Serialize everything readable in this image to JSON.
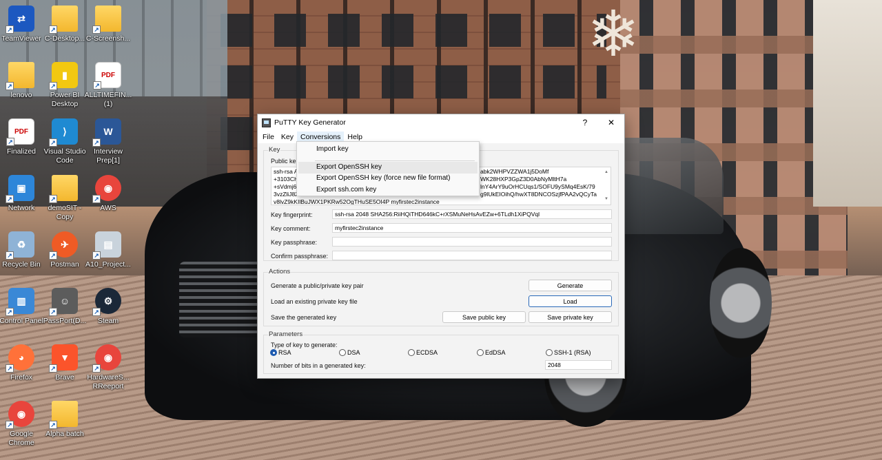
{
  "desktop": {
    "icons": [
      {
        "label": "TeamViewer",
        "glyph": "⇄",
        "color": "#1c58c0"
      },
      {
        "label": "C-Desktop...",
        "glyph": "",
        "color": "folder"
      },
      {
        "label": "C-Screensh...",
        "glyph": "",
        "color": "folder"
      },
      {
        "label": "lenovo",
        "glyph": "",
        "color": "folder"
      },
      {
        "label": "Power BI Desktop",
        "glyph": "▮",
        "color": "#f2c811"
      },
      {
        "label": "ALLTIMEFIN... (1)",
        "glyph": "PDF",
        "color": "pdf"
      },
      {
        "label": "Finalized",
        "glyph": "PDF",
        "color": "pdf"
      },
      {
        "label": "Visual Studio Code",
        "glyph": "⟩",
        "color": "#1f8ad2"
      },
      {
        "label": "Interview Prep[1]",
        "glyph": "W",
        "color": "#2b5797"
      },
      {
        "label": "Network",
        "glyph": "▣",
        "color": "#2d86d9"
      },
      {
        "label": "demoSIT - Copy",
        "glyph": "",
        "color": "folder"
      },
      {
        "label": "AWS",
        "glyph": "◉",
        "color": "#e8453c"
      },
      {
        "label": "Recycle Bin",
        "glyph": "♻",
        "color": "#8fb3d6"
      },
      {
        "label": "Postman",
        "glyph": "✈",
        "color": "#ef5b25"
      },
      {
        "label": "A10_Project...",
        "glyph": "▤",
        "color": "#c9d3dc"
      },
      {
        "label": "Control Panel",
        "glyph": "▥",
        "color": "#3a88d6"
      },
      {
        "label": "PassPort(D...",
        "glyph": "☺",
        "color": "#5c5c5c"
      },
      {
        "label": "Steam",
        "glyph": "⚙",
        "color": "#1b2838"
      },
      {
        "label": "Firefox",
        "glyph": "◕",
        "color": "#ff7139"
      },
      {
        "label": "Brave",
        "glyph": "▼",
        "color": "#fb542b"
      },
      {
        "label": "HardwareS... RReeport",
        "glyph": "◉",
        "color": "#e8453c"
      },
      {
        "label": "Google Chrome",
        "glyph": "◉",
        "color": "#e8453c"
      },
      {
        "label": "Alpha batch",
        "glyph": "",
        "color": "folder"
      }
    ]
  },
  "window": {
    "title": "PuTTY Key Generator",
    "help_btn": "?",
    "close_btn": "✕",
    "menu": [
      "File",
      "Key",
      "Conversions",
      "Help"
    ],
    "key_group": "Key",
    "public_key_label": "Public ke",
    "public_key_lines": [
      "ssh-rsa A",
      "+3103CH",
      "+sVdmj6",
      "3vzZliJ82",
      "v8lvZ9kKIlBuJWX1PKRw52OgTHuSE5OI4P myfirstec2instance"
    ],
    "public_key_right_lines": [
      "abk2WHPVZZWA1j5DoMf",
      "WK28HXP3GpZ3D0AbNyMltH7a",
      "lnY4ArY9uOrHCUqs1/SOFU9ySMq4EsK/79",
      "g9lUkEIOihQ/hwXT8DNCOSzjfPAA2vQCyTa"
    ],
    "fingerprint_label": "Key fingerprint:",
    "fingerprint": "ssh-rsa 2048 SHA256:RiiHQiTHD646kC+rXSMuNeHsAvEZw+6TLdh1XiPQVql",
    "comment_label": "Key comment:",
    "comment": "myfirstec2instance",
    "passphrase_label": "Key passphrase:",
    "confirm_label": "Confirm passphrase:",
    "actions_group": "Actions",
    "generate_text": "Generate a public/private key pair",
    "generate_btn": "Generate",
    "load_text": "Load an existing private key file",
    "load_btn": "Load",
    "save_text": "Save the generated key",
    "save_public_btn": "Save public key",
    "save_private_btn": "Save private key",
    "params_group": "Parameters",
    "type_label": "Type of key to generate:",
    "key_types": [
      "RSA",
      "DSA",
      "ECDSA",
      "EdDSA",
      "SSH-1 (RSA)"
    ],
    "selected_type": "RSA",
    "bits_label": "Number of bits in a generated key:",
    "bits": "2048"
  },
  "conversions_menu": {
    "items": [
      "Import key",
      "Export OpenSSH key",
      "Export OpenSSH key (force new file format)",
      "Export ssh.com key"
    ]
  }
}
